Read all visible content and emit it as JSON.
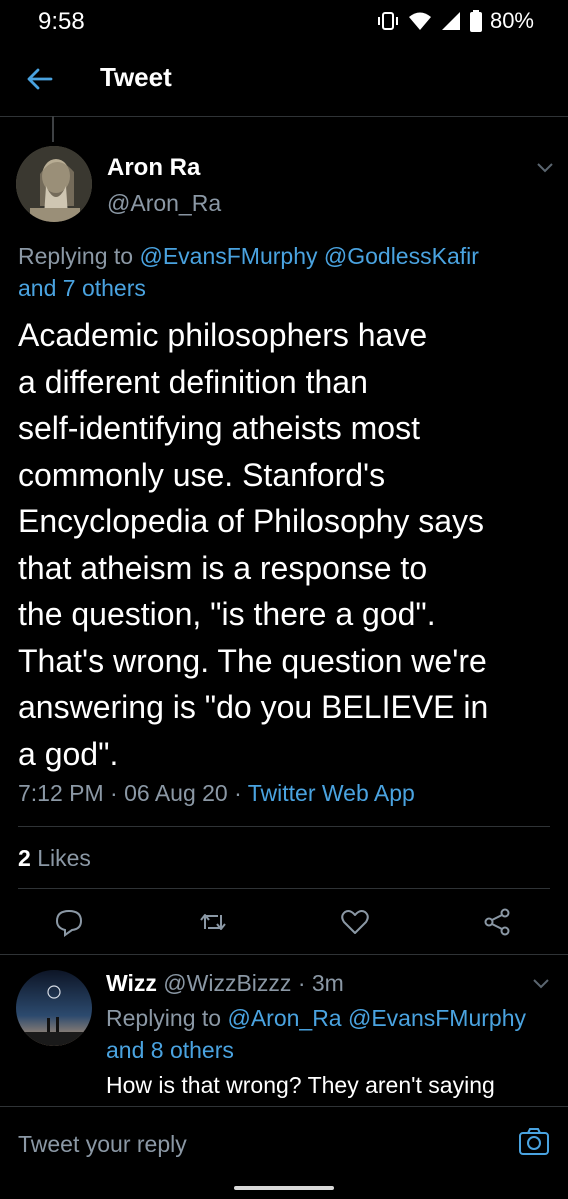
{
  "status_bar": {
    "time": "9:58",
    "battery": "80%"
  },
  "header": {
    "title": "Tweet"
  },
  "tweet": {
    "author_name": "Aron Ra",
    "author_handle": "@Aron_Ra",
    "replying_prefix": "Replying to",
    "replying_users": [
      "@EvansFMurphy",
      "@GodlessKafir"
    ],
    "replying_others": "and 7 others",
    "text": "Academic philosophers have\na different definition than\nself-identifying atheists most\ncommonly use. Stanford's\nEncyclopedia of Philosophy says\nthat atheism is a response to\nthe question, \"is there a god\".\nThat's wrong. The question we're\nanswering is \"do you BELIEVE in\na god\".",
    "time": "7:12 PM",
    "date": "06 Aug 20",
    "sep": "·",
    "source": "Twitter Web App",
    "likes_count": "2",
    "likes_label": "Likes"
  },
  "reply": {
    "author_name": "Wizz",
    "author_handle": "@WizzBizzz",
    "sep": "·",
    "age": "3m",
    "replying_prefix": "Replying to",
    "replying_users": [
      "@Aron_Ra",
      "@EvansFMurphy"
    ],
    "replying_others": "and 8 others",
    "text": "How is that wrong? They aren't saying"
  },
  "compose": {
    "placeholder": "Tweet your reply"
  },
  "colors": {
    "accent": "#4aa3e0",
    "background": "#000000",
    "muted": "#8b98a5"
  }
}
